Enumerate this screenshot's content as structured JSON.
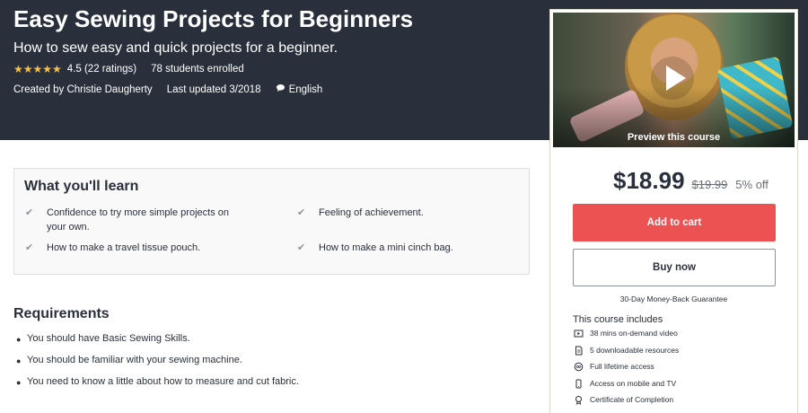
{
  "course": {
    "title": "Easy Sewing Projects for Beginners",
    "subtitle": "How to sew easy and quick projects for a beginner.",
    "stars": "★★★★★",
    "rating_text": "4.5 (22 ratings)",
    "rating_value": 4.5,
    "students": "78 students enrolled",
    "created_by": "Created by Christie Daugherty",
    "last_updated": "Last updated 3/2018",
    "language": "English"
  },
  "preview": {
    "label": "Preview this course",
    "icon": "play-icon"
  },
  "purchase": {
    "price": "$18.99",
    "original_price": "$19.99",
    "discount": "5% off",
    "add_to_cart": "Add to cart",
    "buy_now": "Buy now",
    "guarantee": "30-Day Money-Back Guarantee",
    "includes_title": "This course includes",
    "includes": [
      {
        "icon": "video-icon",
        "label": "38 mins on-demand video"
      },
      {
        "icon": "file-icon",
        "label": "5 downloadable resources"
      },
      {
        "icon": "infinity-icon",
        "label": "Full lifetime access"
      },
      {
        "icon": "mobile-icon",
        "label": "Access on mobile and TV"
      },
      {
        "icon": "certificate-icon",
        "label": "Certificate of Completion"
      }
    ]
  },
  "learn": {
    "title": "What you'll learn",
    "items": [
      "Confidence to try more simple projects on your own.",
      "Feeling of achievement.",
      "How to make a travel tissue pouch.",
      "How to make a mini cinch bag."
    ]
  },
  "requirements": {
    "title": "Requirements",
    "items": [
      "You should have Basic Sewing Skills.",
      "You should be familiar with your sewing machine.",
      "You need to know a little about how to measure and cut fabric."
    ]
  },
  "colors": {
    "hero_bg": "#29303b",
    "star": "#f4c150",
    "cart_button": "#ec5252"
  }
}
